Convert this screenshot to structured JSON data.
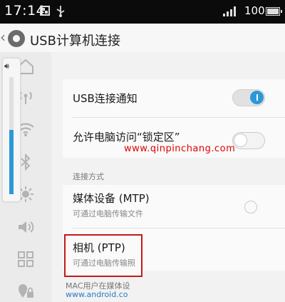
{
  "status_bar": {
    "time": "17:14",
    "battery": "100"
  },
  "title_bar": {
    "title": "USB计算机连接"
  },
  "sidebar": {
    "volume_level": 0.55,
    "icons": [
      "home-icon",
      "hotspot-icon",
      "wifi-icon",
      "bluetooth-icon",
      "brightness-icon",
      "sound-icon",
      "apps-icon",
      "location-lock-icon"
    ]
  },
  "settings": {
    "usb_notify": {
      "label": "USB连接通知",
      "enabled": true
    },
    "lock_access": {
      "label": "允许电脑访问“锁定区”",
      "enabled": false
    },
    "section_header": "连接方式",
    "mtp": {
      "label": "媒体设备 (MTP)",
      "sub": "可通过电脑传输文件"
    },
    "ptp": {
      "label": "相机 (PTP)",
      "sub": "可通过电脑传输照"
    },
    "footnote_line1": "MAC用户在媒体设",
    "footnote_line2": "www.android.co"
  },
  "watermark": "www.qinpinchang.com",
  "colors": {
    "accent": "#2d98d8",
    "highlight_border": "#c41919",
    "watermark": "#e00000",
    "link": "#2a7bc0"
  }
}
